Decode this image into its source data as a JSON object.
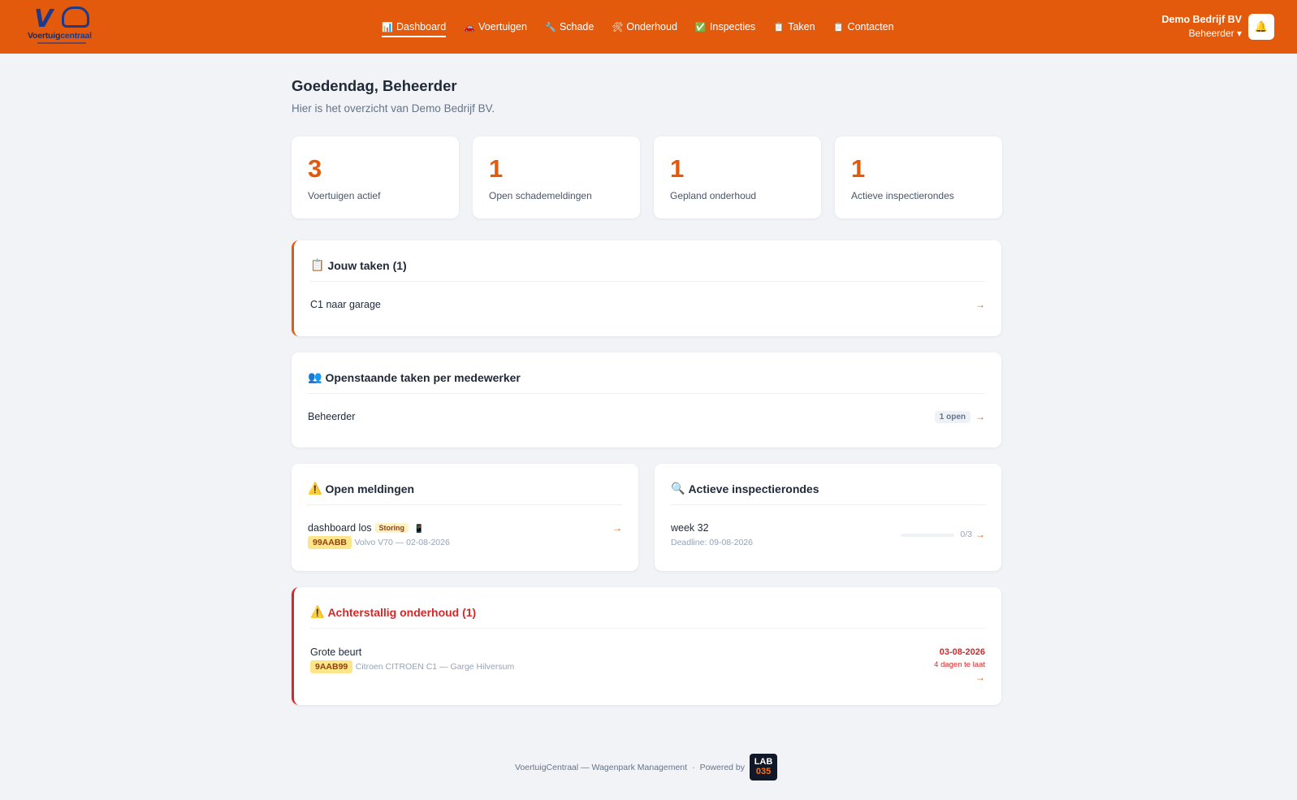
{
  "app": {
    "logo_name_a": "Voertuig",
    "logo_name_b": "centraal"
  },
  "nav": [
    {
      "icon": "📊",
      "icon_name": "chart-icon",
      "label": "Dashboard"
    },
    {
      "icon": "🚗",
      "icon_name": "car-icon",
      "label": "Voertuigen"
    },
    {
      "icon": "🔧",
      "icon_name": "wrench-icon",
      "label": "Schade"
    },
    {
      "icon": "🛠",
      "icon_name": "tools-icon",
      "label": "Onderhoud"
    },
    {
      "icon": "✅",
      "icon_name": "check-icon",
      "label": "Inspecties"
    },
    {
      "icon": "📋",
      "icon_name": "clipboard-icon",
      "label": "Taken"
    },
    {
      "icon": "📋",
      "icon_name": "clipboard-icon",
      "label": "Contacten"
    }
  ],
  "account": {
    "company": "Demo Bedrijf BV",
    "role": "Beheerder ▾"
  },
  "greeting": {
    "title": "Goedendag, Beheerder",
    "subtitle": "Hier is het overzicht van Demo Bedrijf BV."
  },
  "stats": [
    {
      "value": "3",
      "label": "Voertuigen actief"
    },
    {
      "value": "1",
      "label": "Open schademeldingen"
    },
    {
      "value": "1",
      "label": "Gepland onderhoud"
    },
    {
      "value": "1",
      "label": "Actieve inspectierondes"
    }
  ],
  "my_tasks": {
    "icon": "📋",
    "title": "Jouw taken (1)",
    "items": [
      {
        "title": "C1 naar garage"
      }
    ]
  },
  "employee_tasks": {
    "icon": "👥",
    "title": "Openstaande taken per medewerker",
    "items": [
      {
        "name": "Beheerder",
        "count": "1 open"
      }
    ]
  },
  "open_reports": {
    "icon": "⚠️",
    "title": "Open meldingen",
    "items": [
      {
        "title": "dashboard los",
        "tag": "Storing",
        "icon": "📱",
        "plate": "99AABB",
        "meta": "Volvo V70 — 02-08-2026"
      }
    ]
  },
  "active_rounds": {
    "icon": "🔍",
    "title": "Actieve inspectierondes",
    "items": [
      {
        "title": "week 32",
        "deadline": "Deadline: 09-08-2026",
        "progress": "0/3",
        "progress_fraction": 0
      }
    ]
  },
  "overdue": {
    "icon": "⚠️",
    "title": "Achterstallig onderhoud (1)",
    "items": [
      {
        "title": "Grote beurt",
        "plate": "9AAB99",
        "meta": "Citroen CITROEN C1 — Garge Hilversum",
        "date": "03-08-2026",
        "late": "4 dagen te laat"
      }
    ]
  },
  "arrow": "→",
  "bell": "🔔",
  "footer": {
    "text": "VoertuigCentraal — Wagenpark Management",
    "sep": "·",
    "powered": "Powered by",
    "lab_a": "LAB",
    "lab_b": "035"
  },
  "colors": {
    "brand": "#e35a0c",
    "danger": "#dc2626",
    "background": "#f1f3f7"
  }
}
